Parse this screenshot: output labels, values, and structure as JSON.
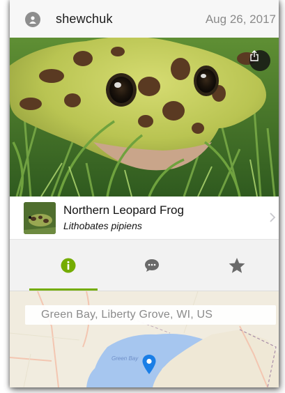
{
  "header": {
    "username": "shewchuk",
    "date": "Aug 26, 2017",
    "avatar_icon": "user-icon"
  },
  "photo": {
    "share_icon": "share-icon"
  },
  "species": {
    "common_name": "Northern Leopard Frog",
    "scientific_name": "Lithobates pipiens",
    "chevron_icon": "chevron-right-icon"
  },
  "tabs": [
    {
      "name": "info",
      "icon": "info-icon",
      "active": true
    },
    {
      "name": "comments",
      "icon": "speech-bubble-icon",
      "active": false
    },
    {
      "name": "favorites",
      "icon": "star-icon",
      "active": false
    }
  ],
  "map": {
    "location": "Green Bay, Liberty Grove, WI, US",
    "water_label": "Green Bay",
    "pin_icon": "map-pin-icon"
  },
  "colors": {
    "accent": "#74ac00",
    "pin": "#1a7ee6",
    "water": "#9fc1ee"
  }
}
